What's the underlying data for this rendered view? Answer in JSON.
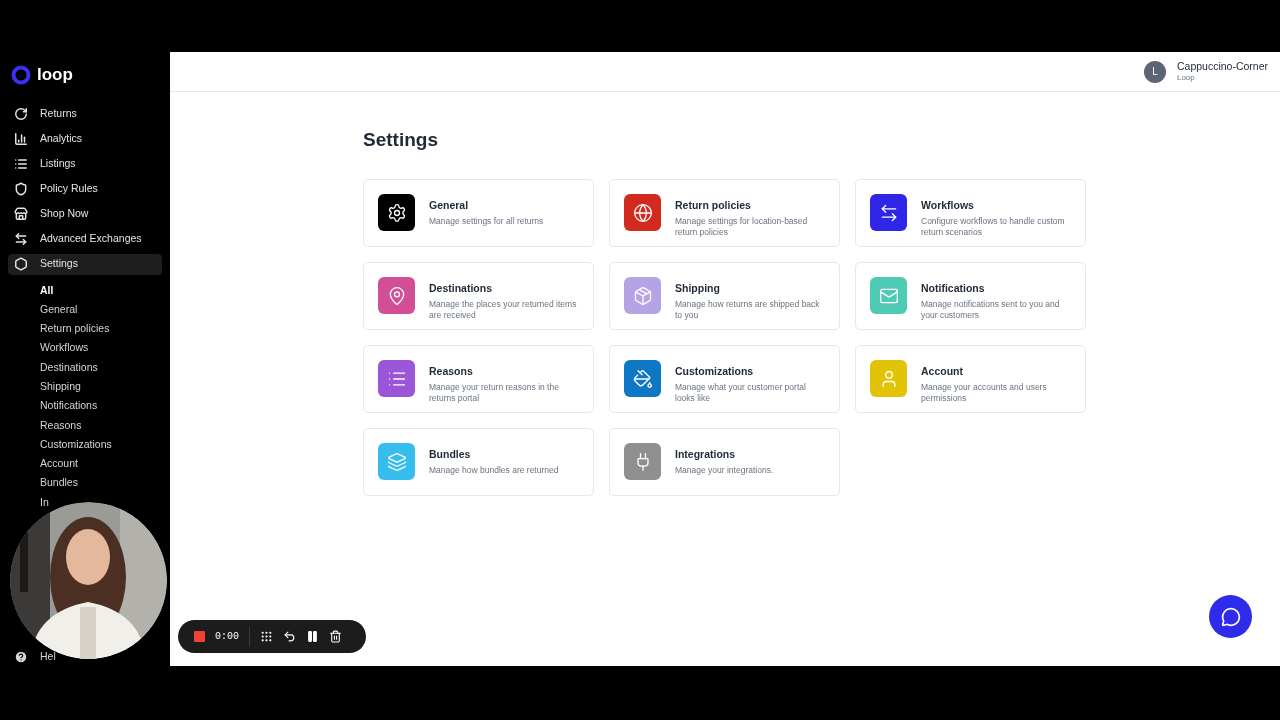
{
  "brand": {
    "name": "loop"
  },
  "sidebar": {
    "items": [
      {
        "label": "Returns",
        "kind": "returns",
        "selected": false
      },
      {
        "label": "Analytics",
        "kind": "analytics",
        "selected": false
      },
      {
        "label": "Listings",
        "kind": "listings",
        "selected": false
      },
      {
        "label": "Policy Rules",
        "kind": "policy",
        "selected": false
      },
      {
        "label": "Shop Now",
        "kind": "shop",
        "selected": false
      },
      {
        "label": "Advanced Exchanges",
        "kind": "exchanges",
        "selected": false
      },
      {
        "label": "Settings",
        "kind": "settings",
        "selected": true
      }
    ],
    "sub_items": [
      {
        "label": "All",
        "selected": true
      },
      {
        "label": "General",
        "selected": false
      },
      {
        "label": "Return policies",
        "selected": false
      },
      {
        "label": "Workflows",
        "selected": false
      },
      {
        "label": "Destinations",
        "selected": false
      },
      {
        "label": "Shipping",
        "selected": false
      },
      {
        "label": "Notifications",
        "selected": false
      },
      {
        "label": "Reasons",
        "selected": false
      },
      {
        "label": "Customizations",
        "selected": false
      },
      {
        "label": "Account",
        "selected": false
      },
      {
        "label": "Bundles",
        "selected": false
      },
      {
        "label": "In",
        "selected": false
      }
    ],
    "help": {
      "label": "Hel"
    }
  },
  "header": {
    "avatar": "L",
    "store": "Cappuccino-Corner",
    "org": "Loop"
  },
  "page": {
    "title": "Settings",
    "cards": [
      {
        "title": "General",
        "description": "Manage settings for all returns",
        "kind": "gear",
        "color": "#000000"
      },
      {
        "title": "Return policies",
        "description": "Manage settings for location-based return policies",
        "kind": "globe",
        "color": "#d22a1f"
      },
      {
        "title": "Workflows",
        "description": "Configure workflows to handle custom return scenarios",
        "kind": "arrows",
        "color": "#3026e8"
      },
      {
        "title": "Destinations",
        "description": "Manage the places your returned items are received",
        "kind": "pin",
        "color": "#d24f96"
      },
      {
        "title": "Shipping",
        "description": "Manage how returns are shipped back to you",
        "kind": "box",
        "color": "#b5a3e6"
      },
      {
        "title": "Notifications",
        "description": "Manage notifications sent to you and your customers",
        "kind": "mail",
        "color": "#4fcbb5"
      },
      {
        "title": "Reasons",
        "description": "Manage your return reasons in the returns portal",
        "kind": "list",
        "color": "#9b55d8"
      },
      {
        "title": "Customizations",
        "description": "Manage what your customer portal looks like",
        "kind": "brush",
        "color": "#0f78c5"
      },
      {
        "title": "Account",
        "description": "Manage your accounts and users permissions",
        "kind": "user",
        "color": "#e2c307"
      },
      {
        "title": "Bundles",
        "description": "Manage how bundles are returned",
        "kind": "layers",
        "color": "#35bdee"
      },
      {
        "title": "Integrations",
        "description": "Manage your integrations.",
        "kind": "plug",
        "color": "#8f8f8f"
      }
    ]
  },
  "recorder": {
    "time": "0:00"
  }
}
